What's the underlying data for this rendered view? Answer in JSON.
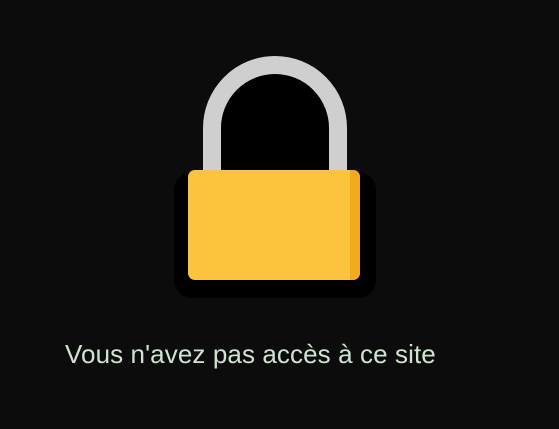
{
  "icon": {
    "name": "padlock-icon",
    "shackle_color": "#cfcfcf",
    "body_color": "#fcc43c",
    "body_shadow_color": "#f2a91d",
    "outline_color": "#000000"
  },
  "message": {
    "text": "Vous n'avez pas accès à ce site",
    "color": "#cfe3cf"
  },
  "background_color": "#0c0c0c"
}
